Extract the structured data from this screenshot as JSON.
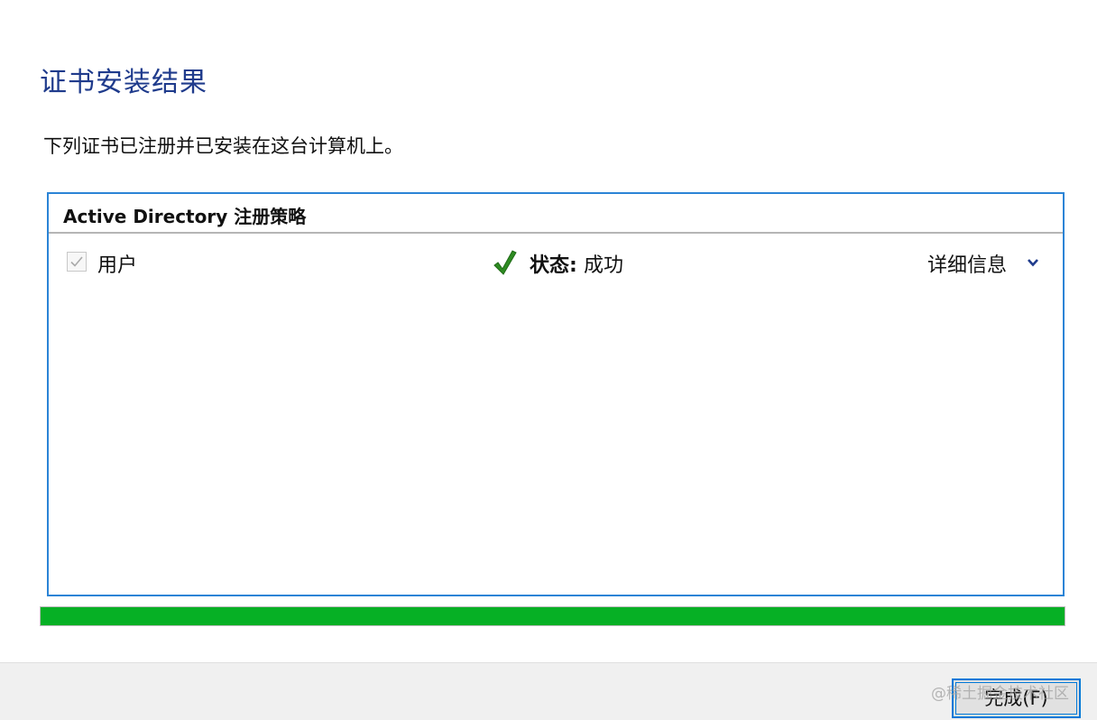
{
  "wizard": {
    "heading": "证书安装结果",
    "description": "下列证书已注册并已安装在这台计算机上。"
  },
  "policy_panel": {
    "title": "Active Directory 注册策略",
    "enrollment": {
      "certificate_label": "用户",
      "checked": true,
      "status_label": "状态:",
      "status_value": "成功",
      "details_label": "详细信息"
    }
  },
  "progress": {
    "fraction": 1.0
  },
  "footer": {
    "finish_label": "完成(F)"
  },
  "watermark": "@稀土掘金技术社区",
  "colors": {
    "heading": "#1f3b8c",
    "panel_border": "#2b84d6",
    "progress_fill": "#06b025",
    "status_check": "#2e8b22",
    "chevron": "#1f3b8c",
    "footer_bg": "#f0f0f0",
    "button_border": "#0078d7"
  },
  "icons": {
    "checkbox": "checkbox-checked-icon",
    "status": "success-check-icon",
    "expand": "chevron-down-icon"
  }
}
